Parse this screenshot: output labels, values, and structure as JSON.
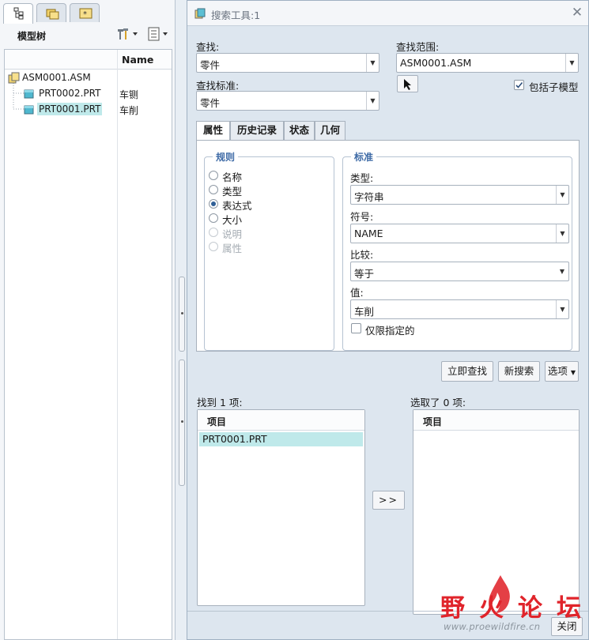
{
  "panel": {
    "tree_title": "模型树",
    "column_name": "Name",
    "tree": [
      {
        "label": "ASM0001.ASM",
        "name_col": ""
      },
      {
        "label": "PRT0002.PRT",
        "name_col": "车铡"
      },
      {
        "label": "PRT0001.PRT",
        "name_col": "车削"
      }
    ]
  },
  "dialog": {
    "title": "搜索工具:1",
    "find_label": "查找:",
    "find_value": "零件",
    "scope_label": "查找范围:",
    "scope_value": "ASM0001.ASM",
    "criteria_label": "查找标准:",
    "criteria_value": "零件",
    "include_sub_label": "包括子模型",
    "include_sub_checked": true,
    "tabs": [
      "属性",
      "历史记录",
      "状态",
      "几何"
    ],
    "rules": {
      "title": "规则",
      "options": [
        {
          "label": "名称",
          "selected": false,
          "disabled": false
        },
        {
          "label": "类型",
          "selected": false,
          "disabled": false
        },
        {
          "label": "表达式",
          "selected": true,
          "disabled": false
        },
        {
          "label": "大小",
          "selected": false,
          "disabled": false
        },
        {
          "label": "说明",
          "selected": false,
          "disabled": true
        },
        {
          "label": "属性",
          "selected": false,
          "disabled": true
        }
      ]
    },
    "criteria": {
      "title": "标准",
      "type_label": "类型:",
      "type_value": "字符串",
      "symbol_label": "符号:",
      "symbol_value": "NAME",
      "compare_label": "比较:",
      "compare_value": "等于",
      "value_label": "值:",
      "value_value": "车削",
      "only_specified_label": "仅限指定的"
    },
    "buttons": {
      "find_now": "立即查找",
      "new_search": "新搜索",
      "options": "选项",
      "transfer": ">>",
      "close": "关闭"
    },
    "found_label": "找到 1 项:",
    "found_header": "项目",
    "found_items": [
      "PRT0001.PRT"
    ],
    "selected_label": "选取了 0 项:",
    "selected_header": "项目"
  },
  "watermark": {
    "text": "野火论坛",
    "sub": "www.proewildfire.cn"
  },
  "colors": {
    "highlight": "#bfe9ea",
    "group_title": "#3d6aa6",
    "watermark_red": "#e0242b"
  }
}
